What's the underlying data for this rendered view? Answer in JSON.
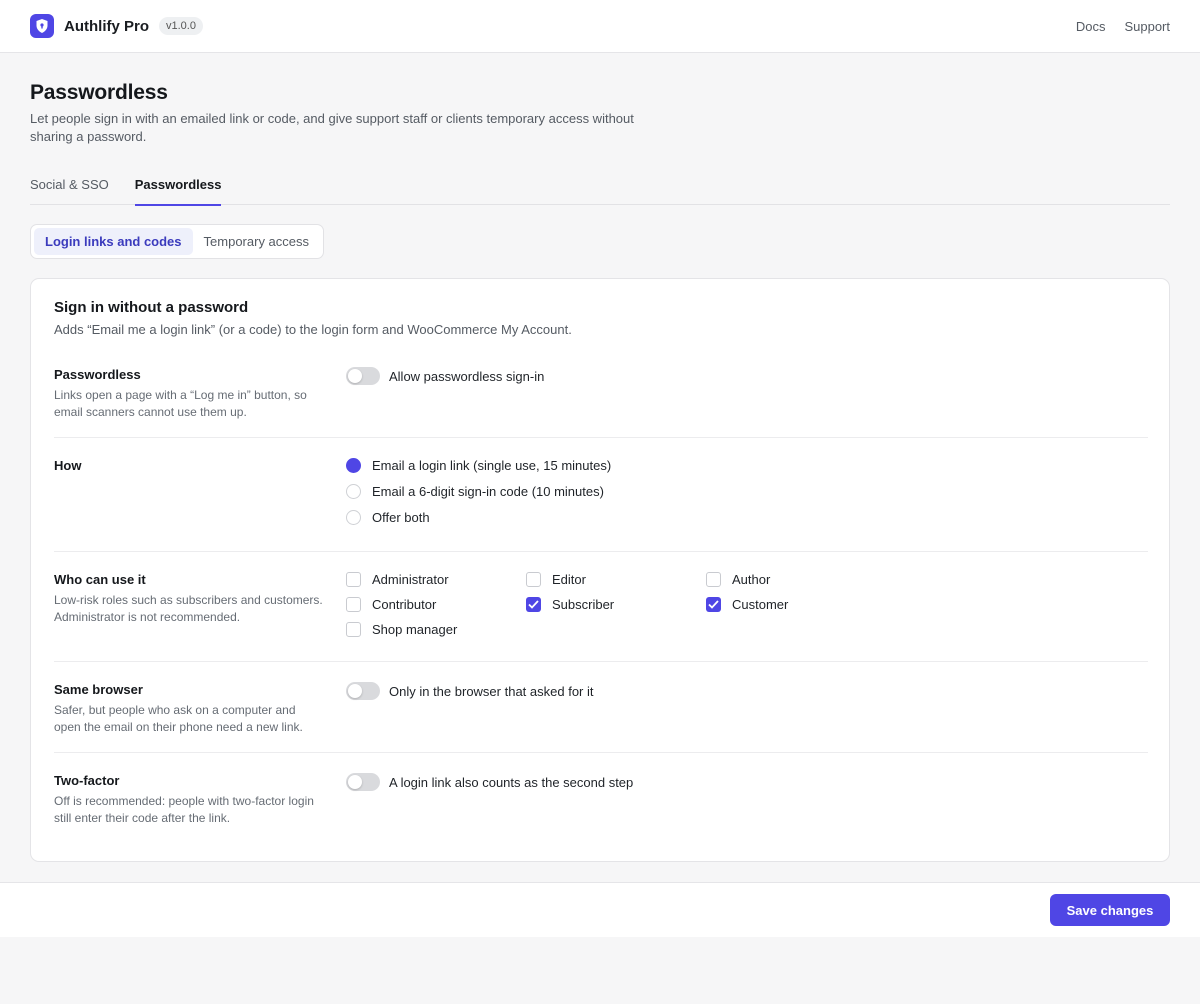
{
  "header": {
    "app_title": "Authlify Pro",
    "version": "v1.0.0",
    "links": [
      "Docs",
      "Support"
    ],
    "logo_icon": "shield-icon",
    "accent": "#4f46e5"
  },
  "page": {
    "title": "Passwordless",
    "description": "Let people sign in with an emailed link or code, and give support staff or clients temporary access without sharing a password."
  },
  "tabs": [
    {
      "label": "Social & SSO",
      "active": false
    },
    {
      "label": "Passwordless",
      "active": true
    }
  ],
  "subtabs": [
    {
      "label": "Login links and codes",
      "active": true
    },
    {
      "label": "Temporary access",
      "active": false
    }
  ],
  "card": {
    "title": "Sign in without a password",
    "description": "Adds “Email me a login link” (or a code) to the login form and WooCommerce My Account.",
    "passwordless": {
      "label": "Passwordless",
      "help": "Links open a page with a “Log me in” button, so email scanners cannot use them up.",
      "toggle_label": "Allow passwordless sign-in",
      "enabled": false
    },
    "how": {
      "label": "How",
      "options": [
        {
          "label": "Email a login link (single use, 15 minutes)",
          "checked": true
        },
        {
          "label": "Email a 6-digit sign-in code (10 minutes)",
          "checked": false
        },
        {
          "label": "Offer both",
          "checked": false
        }
      ]
    },
    "who": {
      "label": "Who can use it",
      "help": "Low-risk roles such as subscribers and customers. Administrator is not recommended.",
      "roles": [
        {
          "label": "Administrator",
          "checked": false
        },
        {
          "label": "Editor",
          "checked": false
        },
        {
          "label": "Author",
          "checked": false
        },
        {
          "label": "Contributor",
          "checked": false
        },
        {
          "label": "Subscriber",
          "checked": true
        },
        {
          "label": "Customer",
          "checked": true
        },
        {
          "label": "Shop manager",
          "checked": false
        }
      ]
    },
    "same_browser": {
      "label": "Same browser",
      "help": "Safer, but people who ask on a computer and open the email on their phone need a new link.",
      "toggle_label": "Only in the browser that asked for it",
      "enabled": false
    },
    "two_factor": {
      "label": "Two-factor",
      "help": "Off is recommended: people with two-factor login still enter their code after the link.",
      "toggle_label": "A login link also counts as the second step",
      "enabled": false
    }
  },
  "footer": {
    "save_label": "Save changes"
  }
}
